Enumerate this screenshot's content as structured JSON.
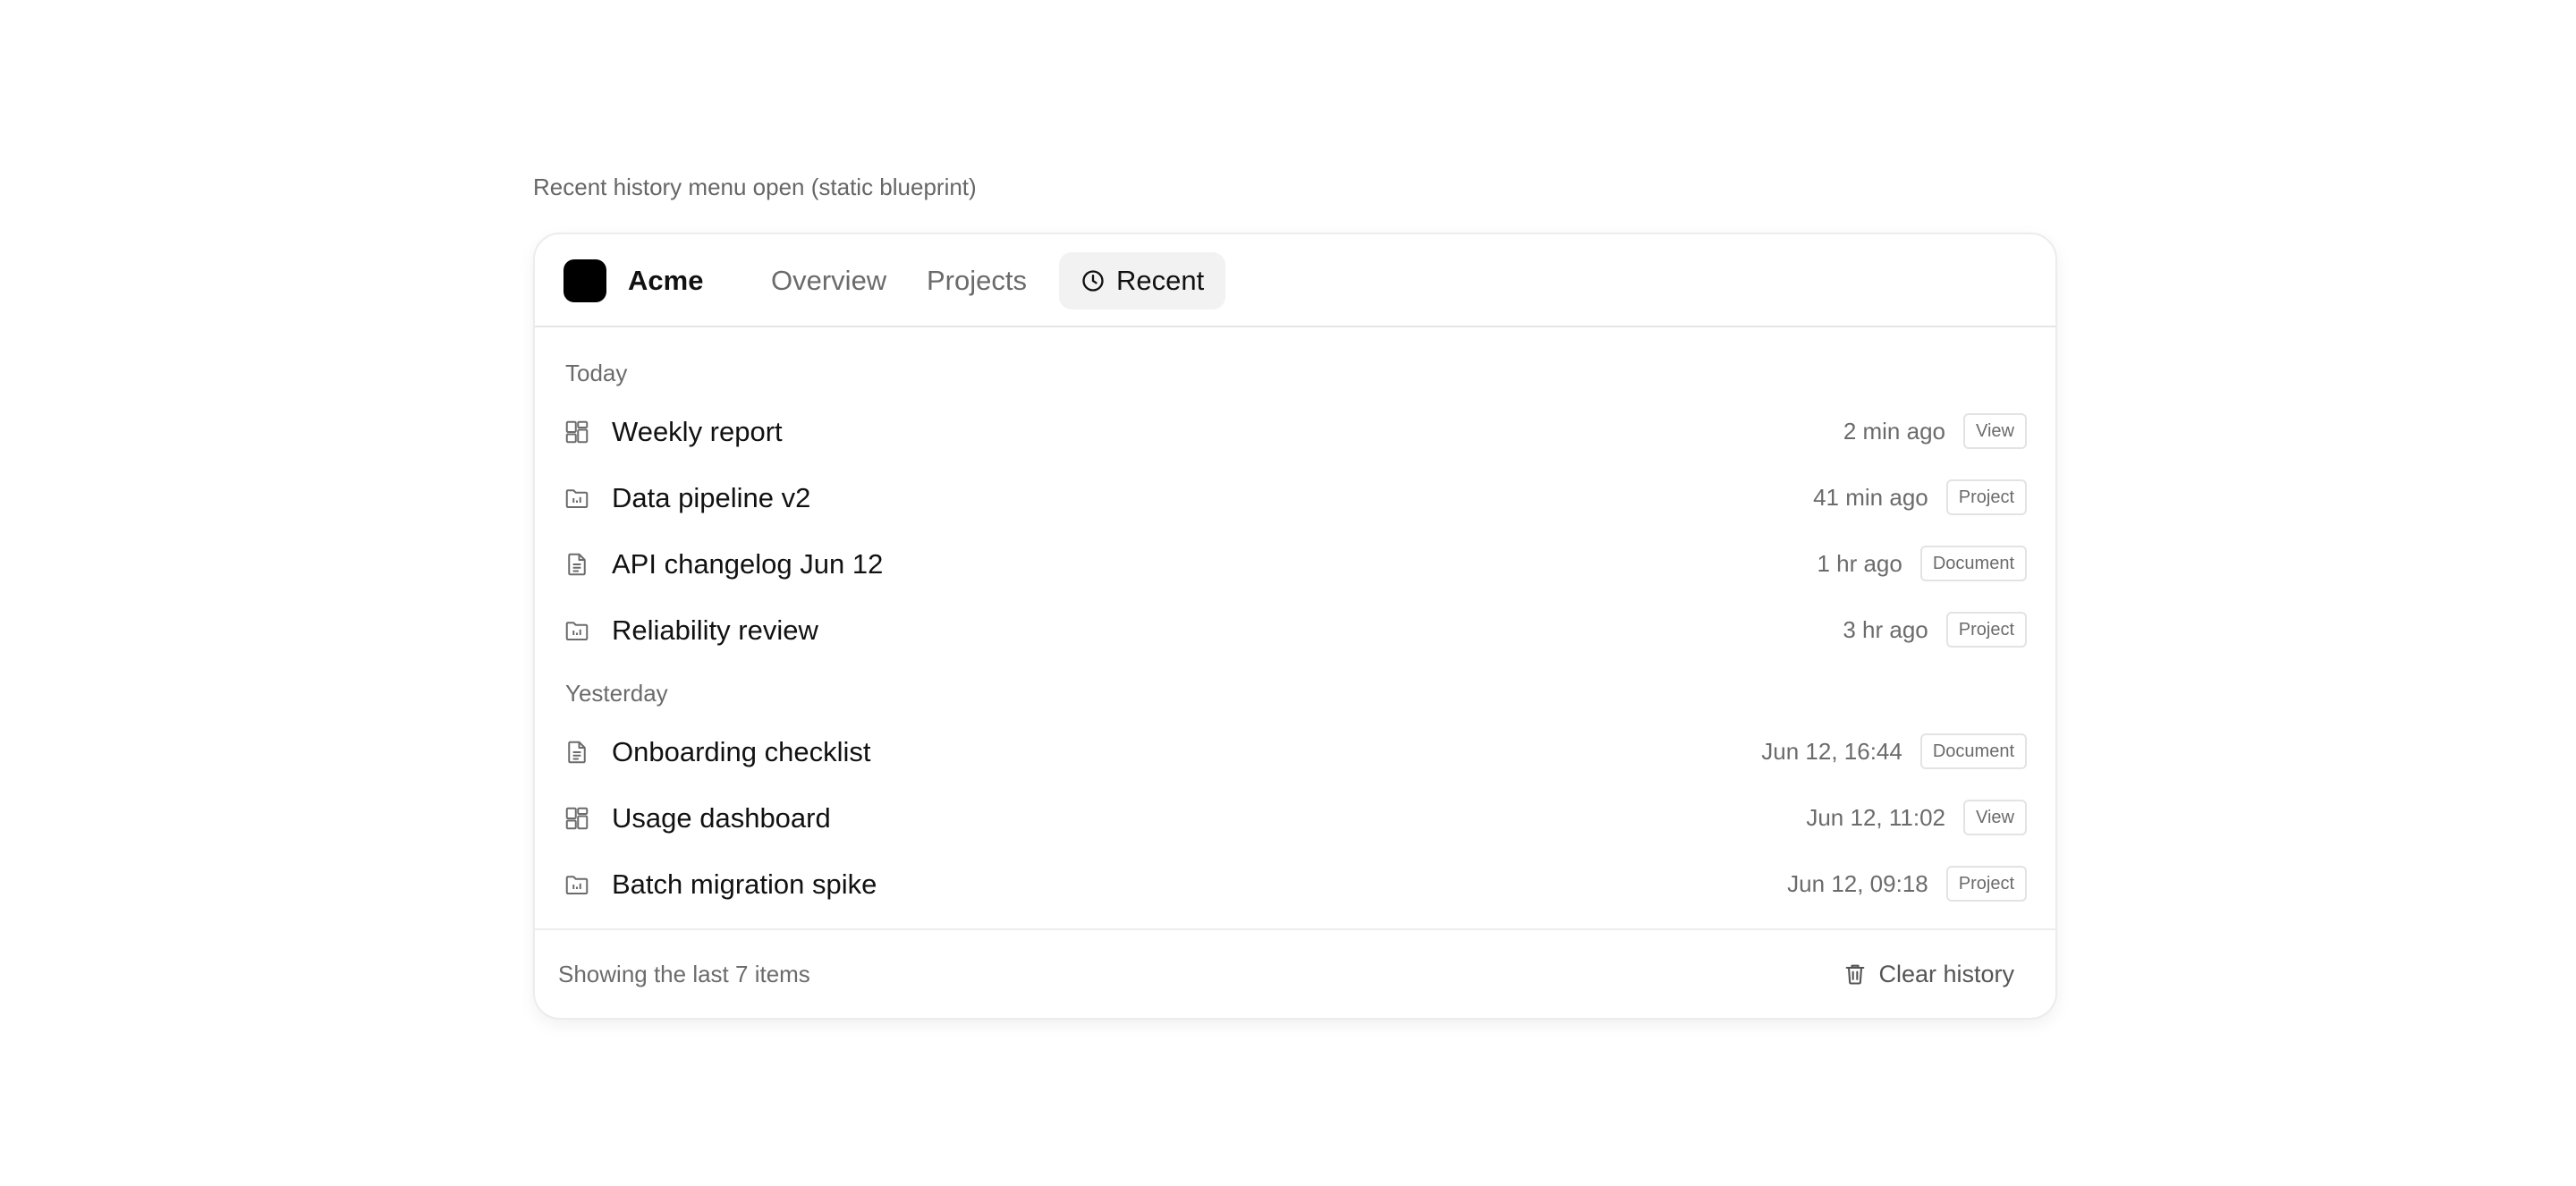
{
  "caption": "Recent history menu open (static blueprint)",
  "brand": {
    "name": "Acme"
  },
  "nav": {
    "tabs": [
      {
        "label": "Overview",
        "active": false
      },
      {
        "label": "Projects",
        "active": false
      },
      {
        "label": "Recent",
        "active": true,
        "icon": "clock-icon"
      }
    ]
  },
  "menu": {
    "sections": [
      {
        "label": "Today",
        "items": [
          {
            "title": "Weekly report",
            "time": "2 min ago",
            "type": "View",
            "icon": "dashboard-icon"
          },
          {
            "title": "Data pipeline v2",
            "time": "41 min ago",
            "type": "Project",
            "icon": "folder-chart-icon"
          },
          {
            "title": "API changelog Jun 12",
            "time": "1 hr ago",
            "type": "Document",
            "icon": "document-icon"
          },
          {
            "title": "Reliability review",
            "time": "3 hr ago",
            "type": "Project",
            "icon": "folder-chart-icon"
          }
        ]
      },
      {
        "label": "Yesterday",
        "items": [
          {
            "title": "Onboarding checklist",
            "time": "Jun 12, 16:44",
            "type": "Document",
            "icon": "document-icon"
          },
          {
            "title": "Usage dashboard",
            "time": "Jun 12, 11:02",
            "type": "View",
            "icon": "dashboard-icon"
          },
          {
            "title": "Batch migration spike",
            "time": "Jun 12, 09:18",
            "type": "Project",
            "icon": "folder-chart-icon"
          }
        ]
      }
    ]
  },
  "footer": {
    "summary": "Showing the last 7 items",
    "clear_label": "Clear history"
  },
  "colors": {
    "text": "#111111",
    "muted": "#6b6b6b",
    "border": "#e6e6e6",
    "active_tab_bg": "#f2f2f2",
    "logo": "#000000"
  }
}
